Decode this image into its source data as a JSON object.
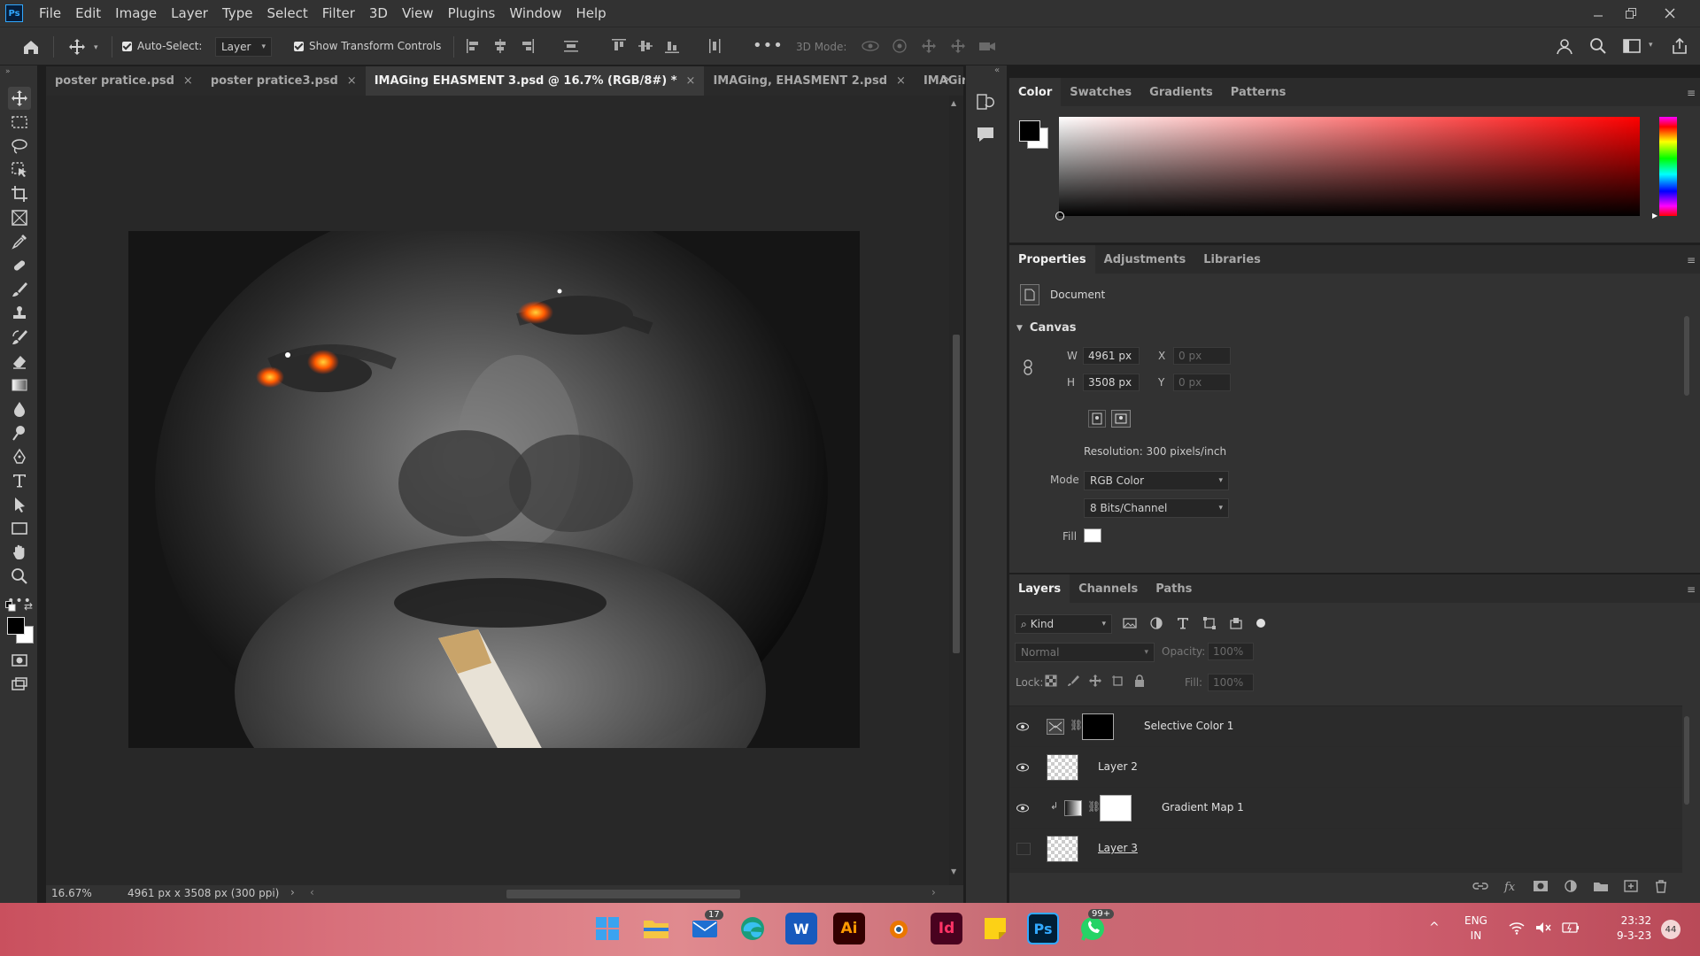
{
  "menubar": {
    "logo": "Ps",
    "items": [
      "File",
      "Edit",
      "Image",
      "Layer",
      "Type",
      "Select",
      "Filter",
      "3D",
      "View",
      "Plugins",
      "Window",
      "Help"
    ]
  },
  "options": {
    "auto_select_label": "Auto-Select:",
    "auto_select_target": "Layer",
    "show_transform_label": "Show Transform Controls",
    "mode3d_label": "3D Mode:"
  },
  "tabs": [
    {
      "label": "poster pratice.psd"
    },
    {
      "label": "poster pratice3.psd"
    },
    {
      "label": "IMAGing EHASMENT 3.psd @ 16.7% (RGB/8#) *"
    },
    {
      "label": "IMAGing, EHASMENT 2.psd"
    },
    {
      "label": "IMAGing,"
    }
  ],
  "status": {
    "zoom": "16.67%",
    "doc_info": "4961 px x 3508 px (300 ppi)"
  },
  "color_panel": {
    "tabs": [
      "Color",
      "Swatches",
      "Gradients",
      "Patterns"
    ]
  },
  "properties_panel": {
    "tabs": [
      "Properties",
      "Adjustments",
      "Libraries"
    ],
    "doc_label": "Document",
    "section": "Canvas",
    "w_label": "W",
    "w_value": "4961 px",
    "h_label": "H",
    "h_value": "3508 px",
    "x_label": "X",
    "x_value": "0 px",
    "y_label": "Y",
    "y_value": "0 px",
    "resolution": "Resolution: 300 pixels/inch",
    "mode_label": "Mode",
    "mode_value": "RGB Color",
    "bits_value": "8 Bits/Channel",
    "fill_label": "Fill"
  },
  "layers_panel": {
    "tabs": [
      "Layers",
      "Channels",
      "Paths"
    ],
    "kind_label": "Kind",
    "blend_mode": "Normal",
    "opacity_label": "Opacity:",
    "opacity_value": "100%",
    "lock_label": "Lock:",
    "fill_label": "Fill:",
    "fill_value": "100%",
    "layers": [
      {
        "name": "Selective Color 1"
      },
      {
        "name": "Layer 2"
      },
      {
        "name": "Gradient Map 1"
      },
      {
        "name": "Layer 3"
      }
    ]
  },
  "taskbar": {
    "mail_badge": "17",
    "whatsapp_badge": "99+",
    "lang_top": "ENG",
    "lang_bottom": "IN",
    "time": "23:32",
    "date": "9-3-23",
    "notif_count": "44"
  }
}
